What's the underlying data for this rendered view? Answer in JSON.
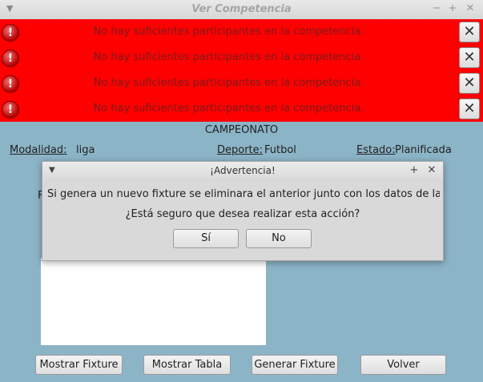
{
  "window": {
    "title": "Ver Competencia"
  },
  "banners": [
    {
      "message": "No hay suficientes participantes en la competencia."
    },
    {
      "message": "No hay suficientes participantes en la competencia."
    },
    {
      "message": "No hay suficientes participantes en la competencia."
    },
    {
      "message": "No hay suficientes participantes en la competencia."
    }
  ],
  "competition": {
    "name": "CAMPEONATO",
    "modalidad_label": "Modalidad:",
    "modalidad_value": "liga",
    "deporte_label": "Deporte:",
    "deporte_value": "Futbol",
    "estado_label": "Estado:",
    "estado_value": "Planificada",
    "partial_label": "F"
  },
  "buttons": {
    "mostrar_fixture": "Mostrar Fixture",
    "mostrar_tabla": "Mostrar Tabla",
    "generar_fixture": "Generar Fixture",
    "volver": "Volver"
  },
  "dialog": {
    "title": "¡Advertencia!",
    "message": "Si genera un nuevo fixture se eliminara el anterior junto con los datos de las partid",
    "question": "¿Está seguro que desea realizar esta acción?",
    "yes": "Sí",
    "no": "No"
  },
  "colors": {
    "banner": "#ff0000",
    "background": "#8cb4c7"
  }
}
